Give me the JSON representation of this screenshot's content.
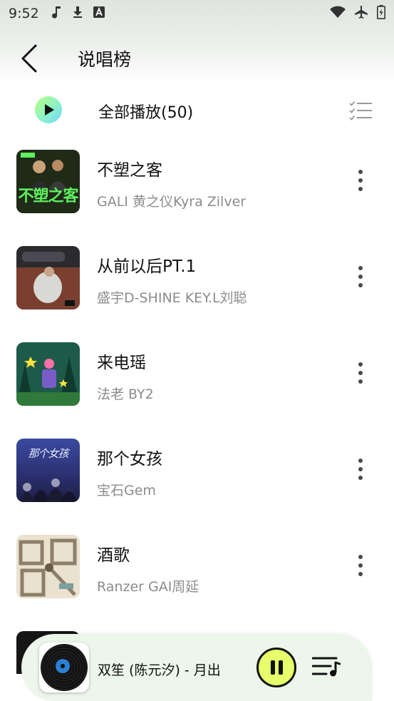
{
  "status_bar": {
    "time": "9:52",
    "left_icons": [
      "music-note-icon",
      "download-icon",
      "font-icon"
    ],
    "right_icons": [
      "wifi-icon",
      "airplane-icon",
      "battery-icon"
    ]
  },
  "header": {
    "title": "说唱榜"
  },
  "play_all": {
    "label": "全部播放(50)"
  },
  "songs": [
    {
      "title": "不塑之客",
      "artist": "GALI 黄之仪Kyra Zilver",
      "cover_text": "不塑之客"
    },
    {
      "title": "从前以后PT.1",
      "artist": "盛宇D-SHINE KEY.L刘聪"
    },
    {
      "title": "来电瑶",
      "artist": "法老 BY2"
    },
    {
      "title": "那个女孩",
      "artist": "宝石Gem",
      "cover_text": "那个女孩"
    },
    {
      "title": "酒歌",
      "artist": "Ranzer GAI周延"
    }
  ],
  "player": {
    "now_playing": "双笙 (陈元汐) - 月出"
  },
  "colors": {
    "accent_yellow": "#e6ff6a",
    "play_gradient_start": "#b8ff7a",
    "play_gradient_end": "#6fd7ff",
    "artist_gray": "#8c8c8c",
    "player_bg": "#ecf6ea"
  }
}
